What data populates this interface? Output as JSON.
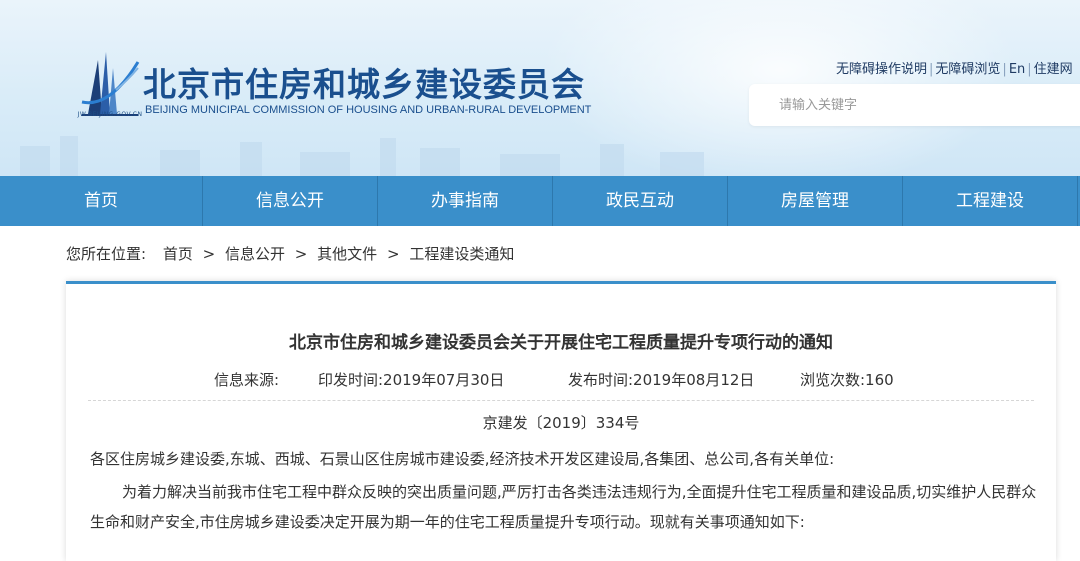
{
  "header": {
    "title": "北京市住房和城乡建设委员会",
    "subtitle": "BEIJING MUNICIPAL COMMISSION OF HOUSING AND URBAN-RURAL DEVELOPMENT",
    "logo_caption": "JW.BEIJING.GOV.CN",
    "top_links": [
      "无障碍操作说明",
      "无障碍浏览",
      "En",
      "住建网"
    ],
    "search_placeholder": "请输入关键字"
  },
  "nav": {
    "items": [
      "首页",
      "信息公开",
      "办事指南",
      "政民互动",
      "房屋管理",
      "工程建设"
    ]
  },
  "breadcrumb": {
    "label": "您所在位置:",
    "items": [
      "首页",
      "信息公开",
      "其他文件",
      "工程建设类通知"
    ],
    "separator": ">"
  },
  "article": {
    "title": "北京市住房和城乡建设委员会关于开展住宅工程质量提升专项行动的通知",
    "source": "信息来源:",
    "print_date": "印发时间:2019年07月30日",
    "publish_date": "发布时间:2019年08月12日",
    "views": "浏览次数:160",
    "doc_number": "京建发〔2019〕334号",
    "greeting": "各区住房城乡建设委,东城、西城、石景山区住房城市建设委,经济技术开发区建设局,各集团、总公司,各有关单位:",
    "body": "为着力解决当前我市住宅工程中群众反映的突出质量问题,严厉打击各类违法违规行为,全面提升住宅工程质量和建设品质,切实维护人民群众生命和财产安全,市住房城乡建设委决定开展为期一年的住宅工程质量提升专项行动。现就有关事项通知如下:"
  },
  "colors": {
    "nav_bg": "#3a8fca",
    "brand_blue": "#1a4f8e",
    "header_bg": "#d9ecf8"
  }
}
